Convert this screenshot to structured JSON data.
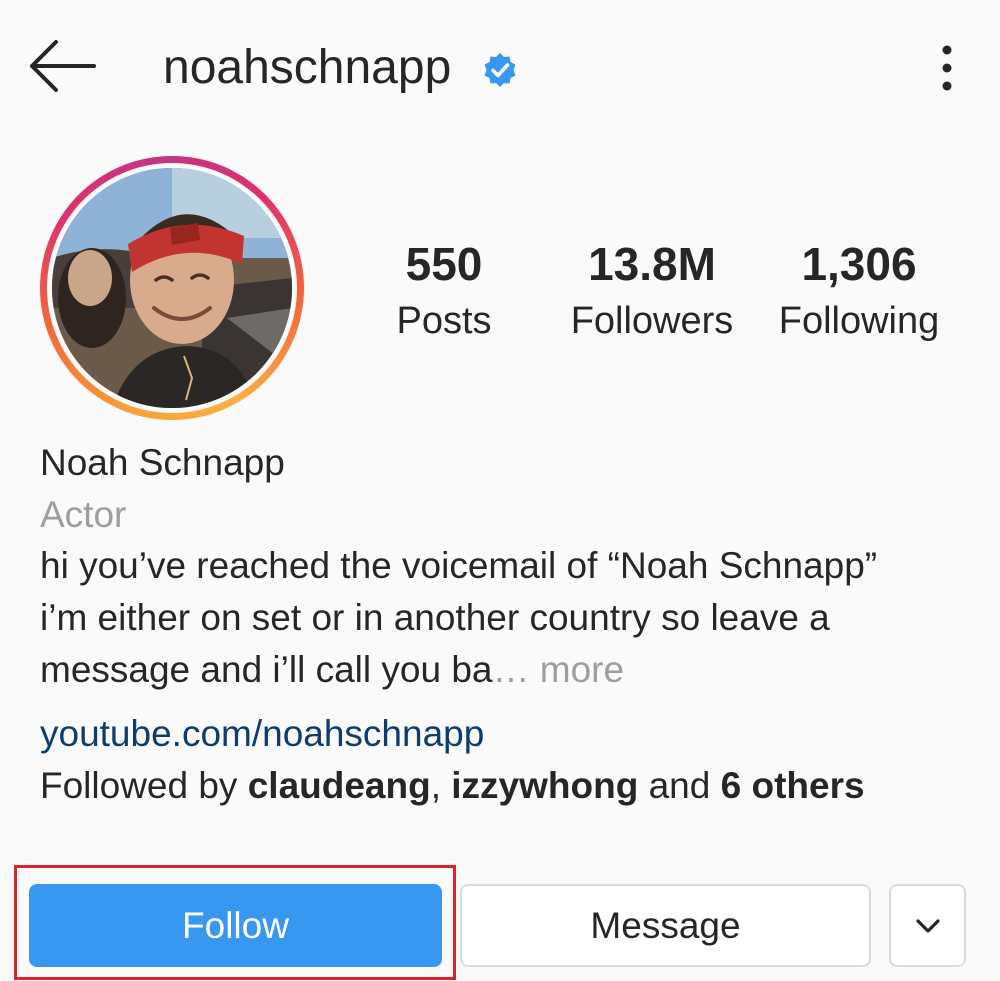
{
  "header": {
    "back_icon": "arrow-left-icon",
    "username": "noahschnapp",
    "verified_icon": "verified-badge-icon",
    "more_icon": "more-vertical-icon"
  },
  "profile": {
    "avatar_icon": "profile-photo",
    "story_ring_colors": [
      "#fcaf45",
      "#f36a3a",
      "#e1306c",
      "#c13584"
    ],
    "full_name": "Noah Schnapp",
    "category": "Actor",
    "bio_lines": [
      "hi you’ve reached the voicemail of “Noah Schnapp”",
      "i’m either on set or in another country so leave a",
      "message and i’ll call you ba"
    ],
    "bio_ellipsis": "… ",
    "bio_more": "more",
    "website": "youtube.com/noahschnapp",
    "followed_by": {
      "prefix": "Followed by ",
      "user1": "claudeang",
      "separator": ", ",
      "user2": "izzywhong",
      "conjunction": " and ",
      "others": "6 others"
    }
  },
  "stats": {
    "posts": {
      "value": "550",
      "label": "Posts"
    },
    "followers": {
      "value": "13.8M",
      "label": "Followers"
    },
    "following": {
      "value": "1,306",
      "label": "Following"
    }
  },
  "actions": {
    "follow_label": "Follow",
    "message_label": "Message",
    "dropdown_icon": "chevron-down-icon"
  },
  "colors": {
    "follow_button": "#3897f0",
    "link": "#0b3d72",
    "verified": "#3897f0",
    "highlight_box": "#d9242b",
    "secondary_text": "#9e9e9e"
  }
}
